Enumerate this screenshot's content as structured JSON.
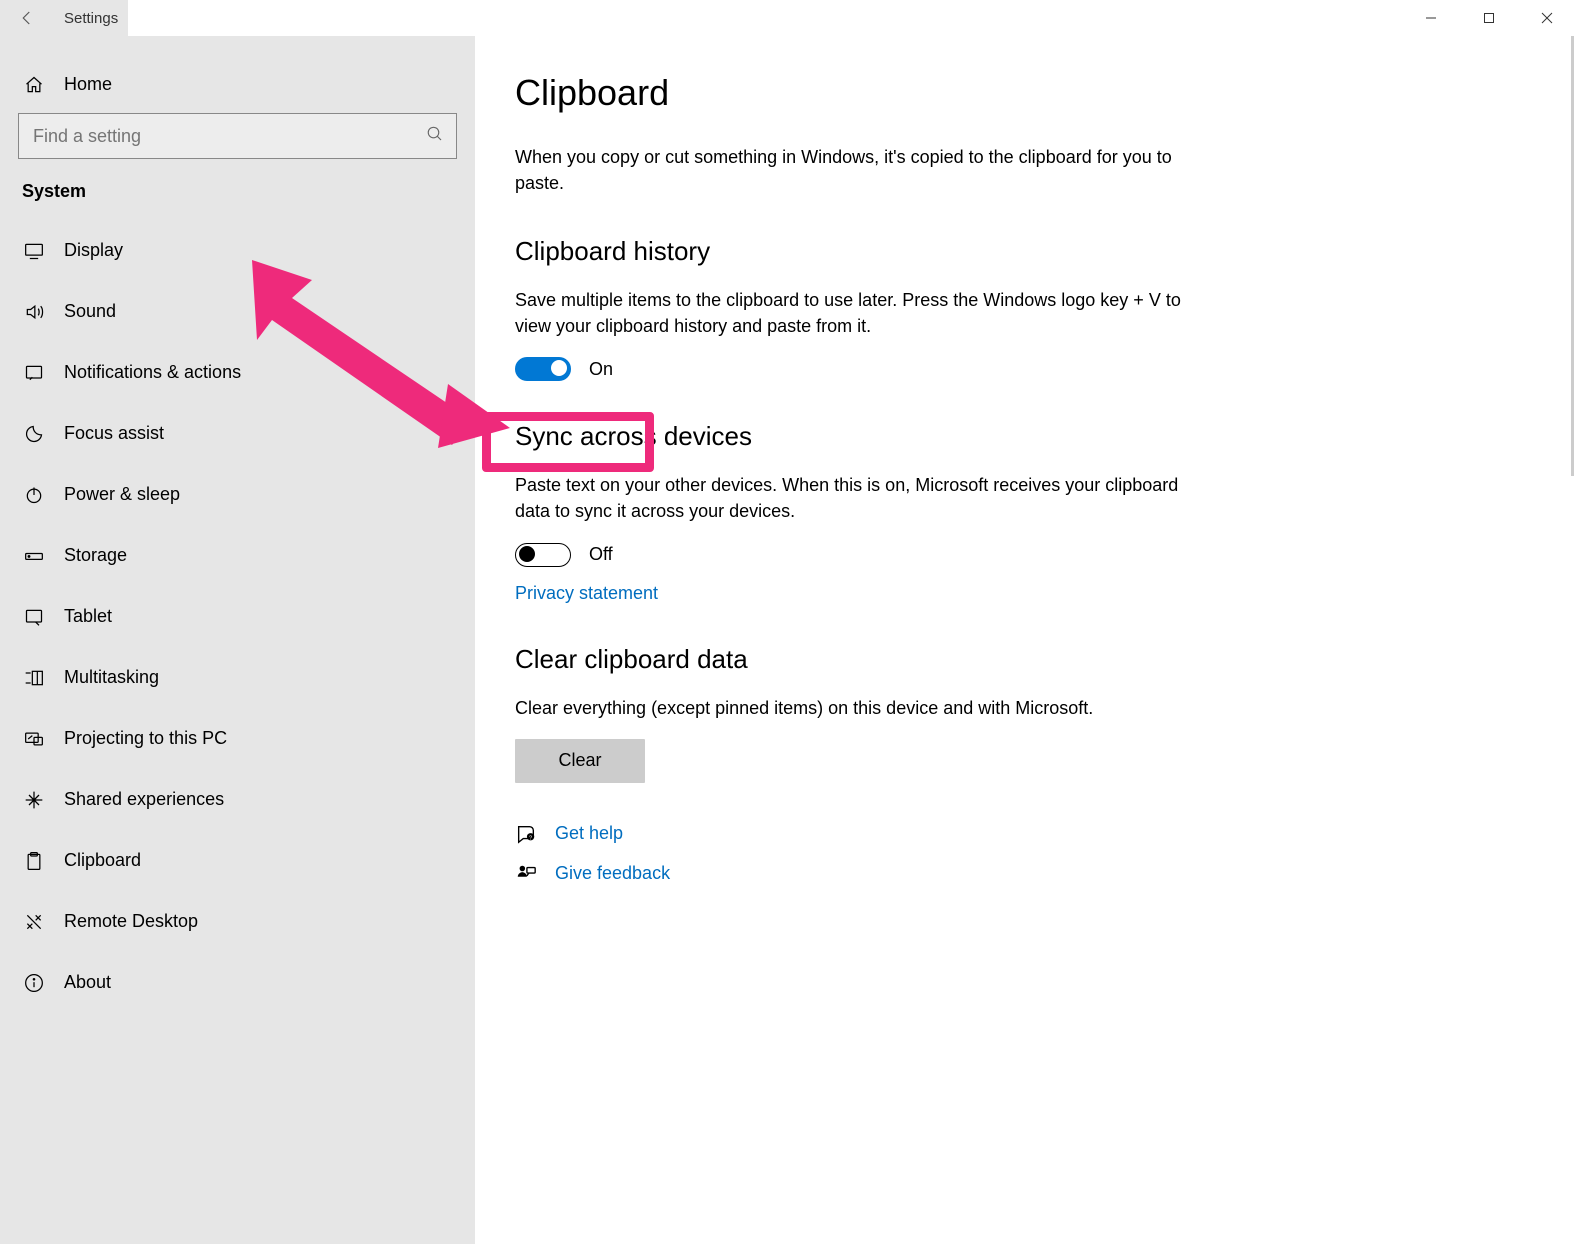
{
  "window": {
    "title": "Settings"
  },
  "sidebar": {
    "home_label": "Home",
    "search_placeholder": "Find a setting",
    "section": "System",
    "items": [
      {
        "label": "Display"
      },
      {
        "label": "Sound"
      },
      {
        "label": "Notifications & actions"
      },
      {
        "label": "Focus assist"
      },
      {
        "label": "Power & sleep"
      },
      {
        "label": "Storage"
      },
      {
        "label": "Tablet"
      },
      {
        "label": "Multitasking"
      },
      {
        "label": "Projecting to this PC"
      },
      {
        "label": "Shared experiences"
      },
      {
        "label": "Clipboard"
      },
      {
        "label": "Remote Desktop"
      },
      {
        "label": "About"
      }
    ]
  },
  "page": {
    "title": "Clipboard",
    "intro": "When you copy or cut something in Windows, it's copied to the clipboard for you to paste.",
    "history": {
      "heading": "Clipboard history",
      "descr": "Save multiple items to the clipboard to use later. Press the Windows logo key + V to view your clipboard history and paste from it.",
      "toggle_label": "On"
    },
    "sync": {
      "heading": "Sync across devices",
      "descr": "Paste text on your other devices. When this is on, Microsoft receives your clipboard data to sync it across your devices.",
      "toggle_label": "Off",
      "privacy_link": "Privacy statement"
    },
    "clear": {
      "heading": "Clear clipboard data",
      "descr": "Clear everything (except pinned items) on this device and with Microsoft.",
      "button": "Clear"
    },
    "help": {
      "get_help": "Get help",
      "feedback": "Give feedback"
    }
  },
  "colors": {
    "accent": "#0178d4",
    "highlight": "#ee2a7b"
  }
}
